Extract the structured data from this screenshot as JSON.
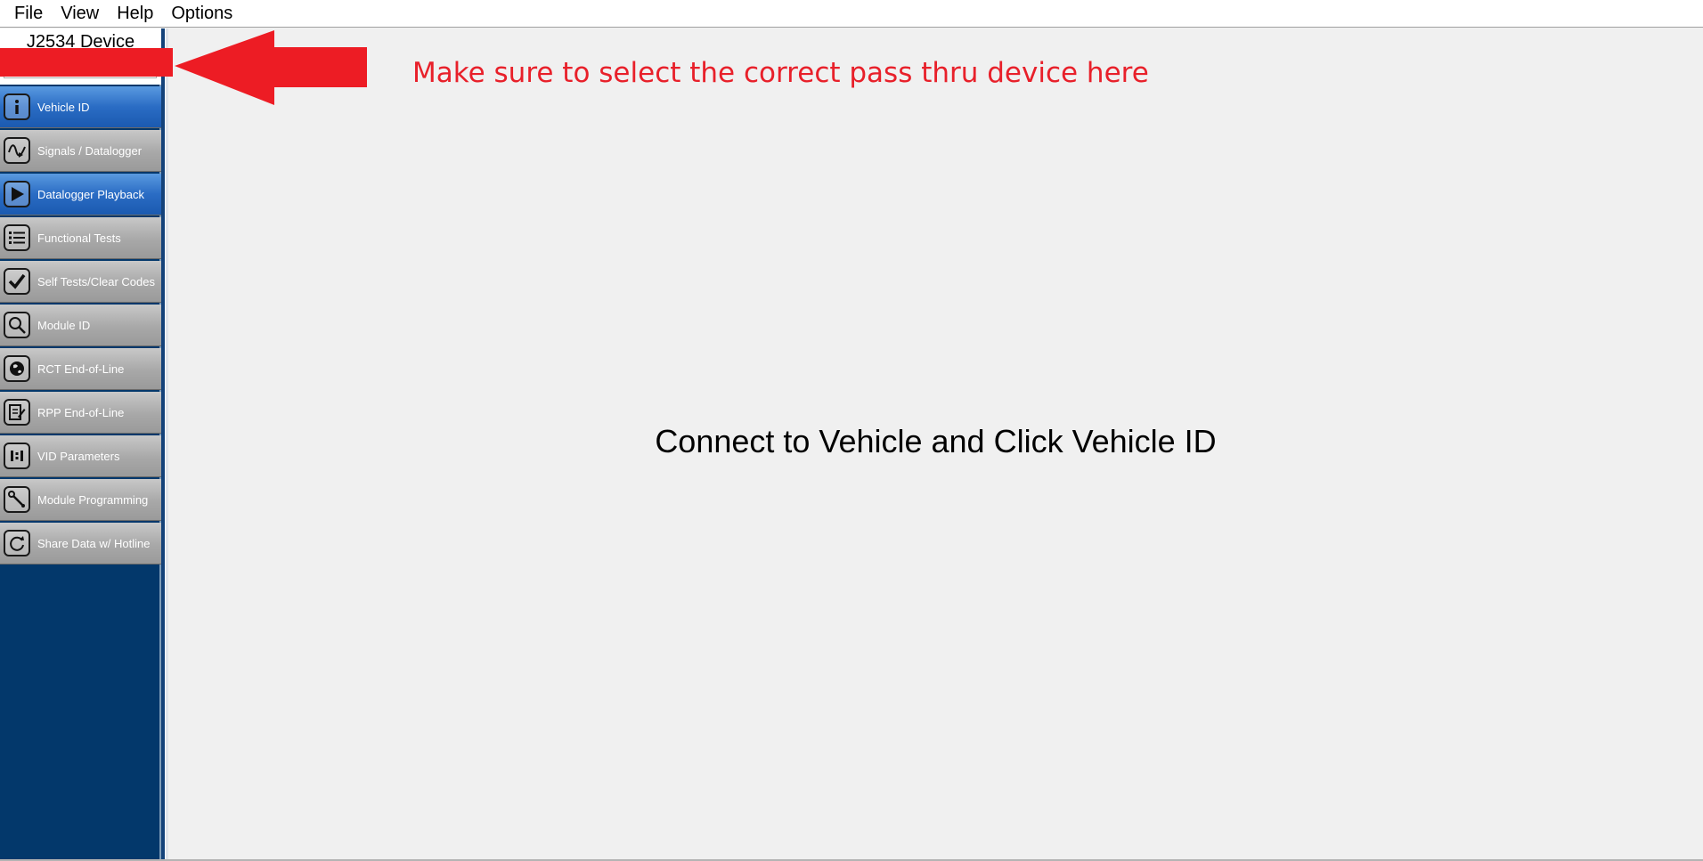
{
  "menu": [
    {
      "id": "file",
      "label": "File"
    },
    {
      "id": "view",
      "label": "View"
    },
    {
      "id": "help",
      "label": "Help"
    },
    {
      "id": "options",
      "label": "Options"
    }
  ],
  "device": {
    "label": "J2534 Device"
  },
  "nav": [
    {
      "id": "vehicle-id",
      "label": "Vehicle ID",
      "icon": "info-icon"
    },
    {
      "id": "signals-datalogger",
      "label": "Signals / Datalogger",
      "icon": "waveform-icon"
    },
    {
      "id": "datalogger-playback",
      "label": "Datalogger Playback",
      "icon": "play-icon"
    },
    {
      "id": "functional-tests",
      "label": "Functional Tests",
      "icon": "list-icon"
    },
    {
      "id": "self-tests",
      "label": "Self Tests/Clear Codes",
      "icon": "checkmark-icon"
    },
    {
      "id": "module-id",
      "label": "Module ID",
      "icon": "magnifier-icon"
    },
    {
      "id": "rct-eol",
      "label": "RCT End-of-Line",
      "icon": "globe-icon"
    },
    {
      "id": "rpp-eol",
      "label": "RPP End-of-Line",
      "icon": "edit-document-icon"
    },
    {
      "id": "vid-parameters",
      "label": "VID Parameters",
      "icon": "parameters-icon"
    },
    {
      "id": "module-programming",
      "label": "Module Programming",
      "icon": "wrench-icon"
    },
    {
      "id": "share-data",
      "label": "Share Data w/ Hotline",
      "icon": "sync-icon"
    }
  ],
  "main": {
    "message": "Connect to Vehicle and Click Vehicle ID"
  },
  "annotation": {
    "text": "Make sure to select the correct pass thru device here",
    "color": "#e8202a"
  },
  "colors": {
    "sidebar": "#03386b",
    "active_item": "#2a6cc4",
    "inactive_item": "#a8a8a8",
    "arrow": "#ed1c24"
  }
}
